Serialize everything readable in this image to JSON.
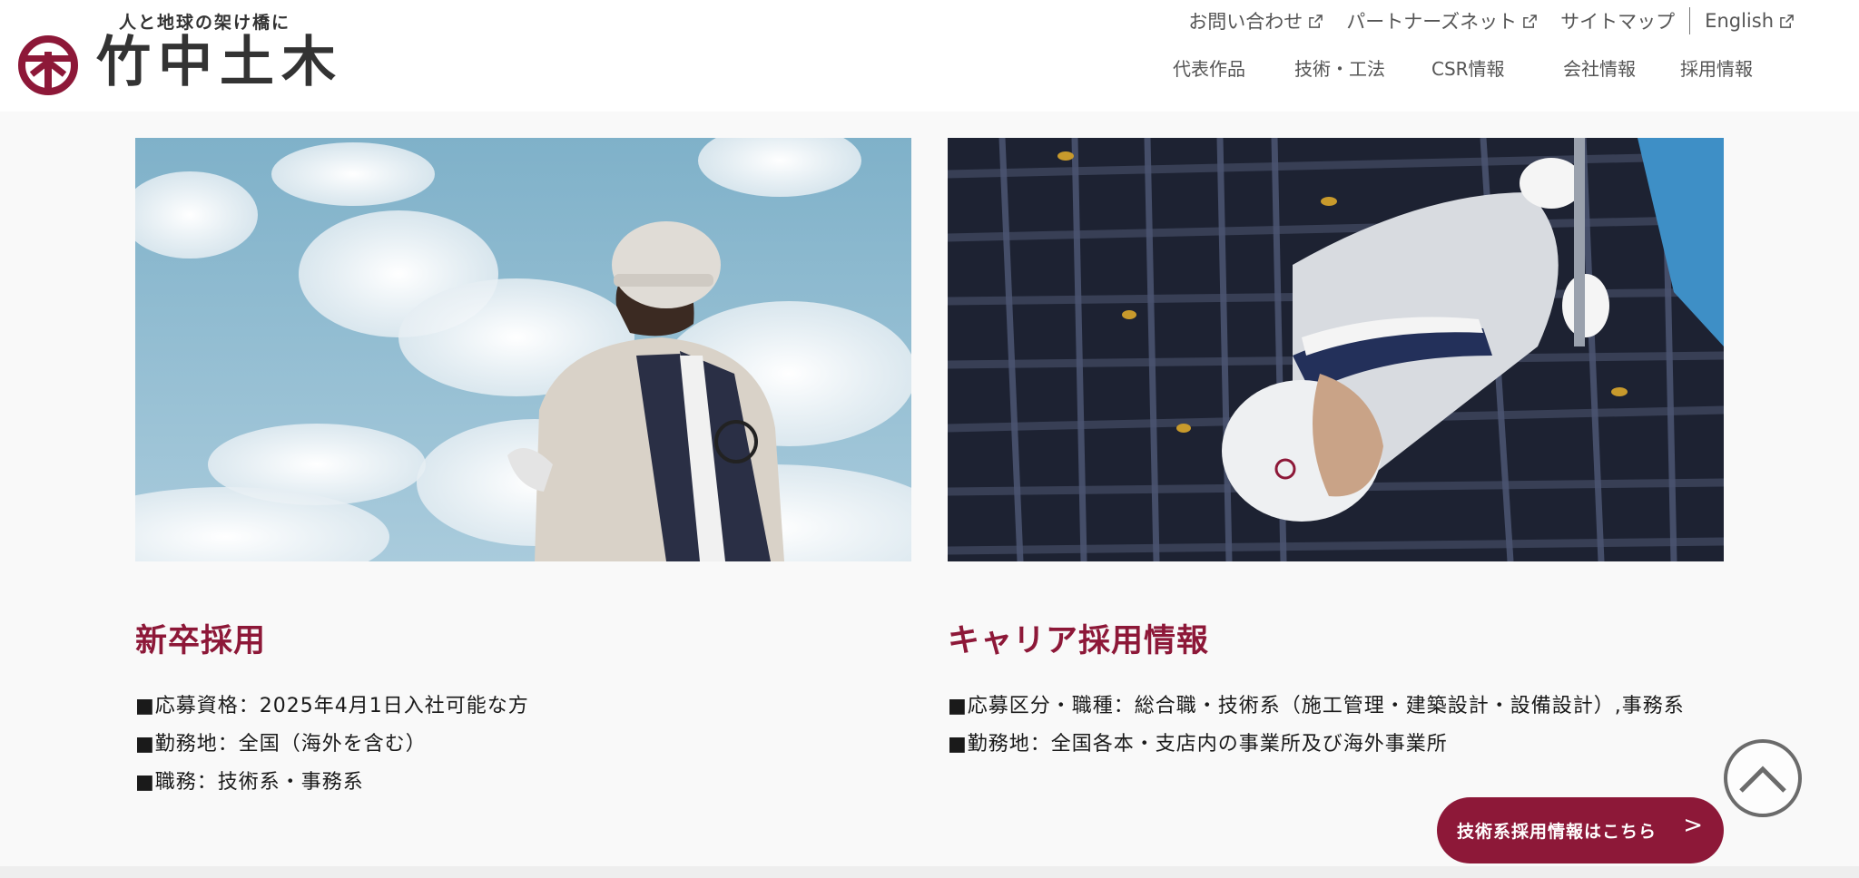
{
  "brand": {
    "tagline": "人と地球の架け橋に",
    "name": "竹中土木",
    "color": "#8d1838"
  },
  "utility_nav": [
    {
      "label": "お問い合わせ",
      "icon": "external-link-icon"
    },
    {
      "label": "パートナーズネット",
      "icon": "external-link-icon"
    },
    {
      "label": "サイトマップ",
      "icon": ""
    },
    {
      "label": "English",
      "icon": "external-link-icon"
    }
  ],
  "global_nav": [
    "代表作品",
    "技術・工法",
    "CSR情報",
    "会社情報",
    "採用情報"
  ],
  "cards": [
    {
      "title": "新卒採用",
      "lines": [
        "■応募資格：2025年4月1日入社可能な方",
        "■勤務地：全国（海外を含む）",
        "■職務：技術系・事務系"
      ]
    },
    {
      "title": "キャリア採用情報",
      "lines": [
        "■応募区分・職種：総合職・技術系（施工管理・建築設計・設備設計）,事務系",
        "■勤務地：全国各本・支店内の事業所及び海外事業所"
      ]
    }
  ],
  "cta": {
    "label": "技術系採用情報はこちら",
    "arrow": ">"
  },
  "back_to_top": {
    "icon": "chevron-up-icon"
  }
}
